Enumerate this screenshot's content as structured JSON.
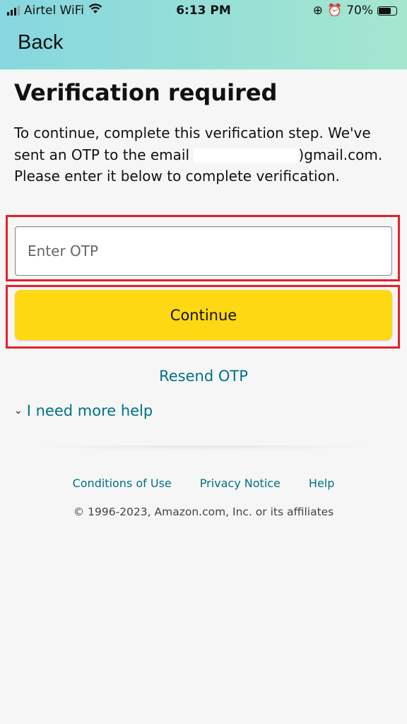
{
  "status_bar": {
    "carrier": "Airtel WiFi",
    "time": "6:13 PM",
    "battery": "70%",
    "battery_level": 0.7,
    "icons": [
      "signal-icon",
      "wifi-icon",
      "rotation-lock-icon",
      "alarm-icon",
      "battery-icon"
    ]
  },
  "nav": {
    "back_label": "Back"
  },
  "main": {
    "title": "Verification required",
    "description_part1": "To continue, complete this verification step. We've sent an OTP to the email ",
    "description_email_visible": ")gmail.com",
    "description_part2": ". Please enter it below to complete verification.",
    "otp_placeholder": "Enter OTP",
    "otp_value": "",
    "continue_label": "Continue",
    "resend_label": "Resend OTP",
    "help_label": "I need more help"
  },
  "footer": {
    "links": [
      "Conditions of Use",
      "Privacy Notice",
      "Help"
    ],
    "copyright": "© 1996-2023, Amazon.com, Inc. or its affiliates"
  },
  "colors": {
    "button": "#ffd814",
    "link": "#007185",
    "highlight": "#e4202a"
  }
}
